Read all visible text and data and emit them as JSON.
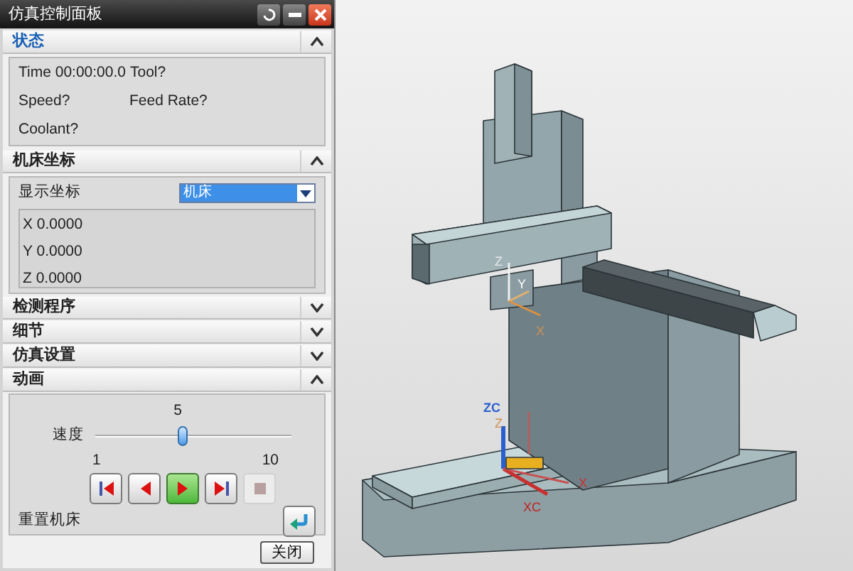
{
  "window": {
    "title": "仿真控制面板"
  },
  "sections": [
    {
      "kind": "status",
      "title": "状态",
      "expanded": true,
      "active": true,
      "time": "Time 00:00:00.0",
      "tool": "Tool?",
      "speed": "Speed?",
      "feed_rate": "Feed Rate?",
      "coolant": "Coolant?"
    },
    {
      "kind": "coordinates",
      "title": "机床坐标",
      "expanded": true,
      "active": false,
      "label": "显示坐标",
      "value": "机床",
      "readings": [
        "X 0.0000",
        "Y 0.0000",
        "Z 0.0000"
      ]
    },
    {
      "title": "检测程序",
      "expanded": false,
      "active": false
    },
    {
      "title": "细节",
      "expanded": false,
      "active": false
    },
    {
      "title": "仿真设置",
      "expanded": false,
      "active": false
    },
    {
      "kind": "animation",
      "title": "动画",
      "expanded": true,
      "active": false,
      "speed_label": "速度",
      "speed_value": "5",
      "level": 0.44,
      "min": "1",
      "max": "10",
      "controls": [
        {
          "kind": "first",
          "selected": false,
          "disabled": false
        },
        {
          "kind": "back",
          "selected": false,
          "disabled": false
        },
        {
          "kind": "play",
          "selected": true,
          "disabled": false
        },
        {
          "kind": "last",
          "selected": false,
          "disabled": false
        },
        {
          "kind": "stop",
          "selected": false,
          "disabled": true
        }
      ],
      "reset_label": "重置机床"
    }
  ],
  "close_button": "关闭",
  "viewport": {
    "axis_labels": [
      "Z",
      "Y",
      "X",
      "ZC",
      "Z",
      "XC",
      "X"
    ]
  }
}
